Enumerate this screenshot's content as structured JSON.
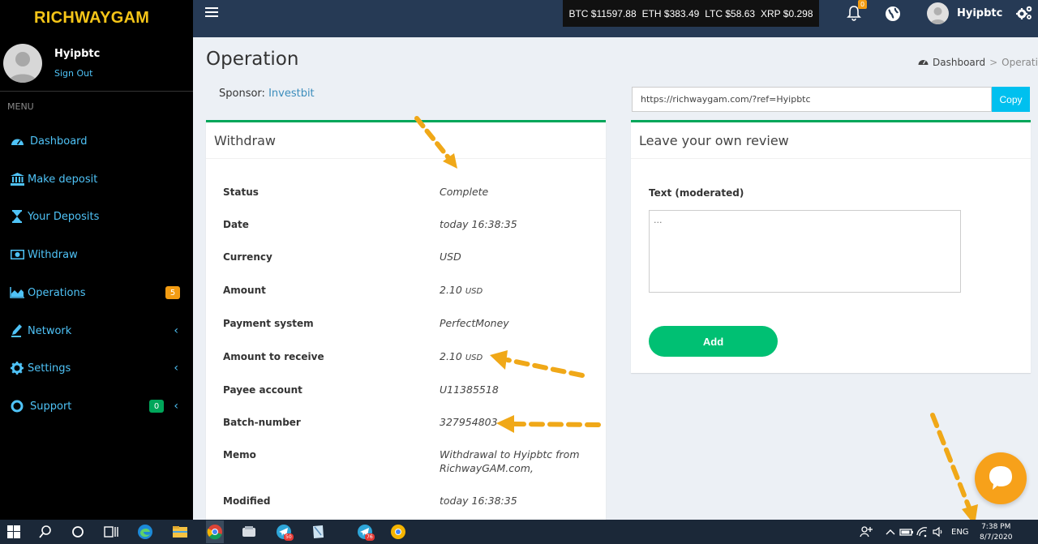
{
  "brand": "RICHWAYGAM",
  "user": {
    "name": "Hyipbtc",
    "sign_out": "Sign Out"
  },
  "menu": {
    "header": "MENU",
    "items": [
      {
        "label": "Dashboard",
        "icon": "dashboard-icon"
      },
      {
        "label": "Make deposit",
        "icon": "bank-icon"
      },
      {
        "label": "Your Deposits",
        "icon": "hourglass-icon"
      },
      {
        "label": "Withdraw",
        "icon": "money-icon"
      },
      {
        "label": "Operations",
        "icon": "area-chart-icon",
        "badge": "5",
        "badge_color": "#f39c12"
      },
      {
        "label": "Network",
        "icon": "pen-icon",
        "chevron": "‹"
      },
      {
        "label": "Settings",
        "icon": "gear-icon",
        "chevron": "‹"
      },
      {
        "label": "Support",
        "icon": "lifebuoy-icon",
        "badge": "0",
        "badge_color": "#00a65a",
        "chevron": "‹"
      }
    ]
  },
  "topbar": {
    "ticker": [
      "BTC $11597.88",
      "ETH $383.49",
      "LTC $58.63",
      "XRP $0.298"
    ],
    "notifications": "0",
    "username": "Hyipbtc"
  },
  "page": {
    "title": "Operation",
    "breadcrumb": {
      "home": "Dashboard",
      "separator": ">",
      "current": "Operation"
    },
    "sponsor_label": "Sponsor:",
    "sponsor_name": "Investbit",
    "ref_link": "https://richwaygam.com/?ref=Hyipbtc",
    "copy_label": "Copy"
  },
  "withdraw": {
    "title": "Withdraw",
    "rows": [
      {
        "label": "Status",
        "value": "Complete"
      },
      {
        "label": "Date",
        "value": "today 16:38:35"
      },
      {
        "label": "Currency",
        "value": "USD"
      },
      {
        "label": "Amount",
        "value": "2.10",
        "unit": "USD"
      },
      {
        "label": "Payment system",
        "value": "PerfectMoney"
      },
      {
        "label": "Amount to receive",
        "value": "2.10",
        "unit": "USD"
      },
      {
        "label": "Payee account",
        "value": "U11385518"
      },
      {
        "label": "Batch-number",
        "value": "327954803"
      },
      {
        "label": "Memo",
        "value": "Withdrawal to Hyipbtc from RichwayGAM.com,"
      },
      {
        "label": "Modified",
        "value": "today 16:38:35"
      }
    ]
  },
  "review": {
    "title": "Leave your own review",
    "text_label": "Text (moderated)",
    "placeholder": "...",
    "add_label": "Add"
  },
  "taskbar": {
    "badge_telegram_1": "50",
    "badge_telegram_2": "76",
    "lang": "ENG",
    "time": "7:38 PM",
    "date": "8/7/2020"
  },
  "colors": {
    "accent_green": "#00a65a",
    "brand_yellow": "#f5c518",
    "link_blue": "#4fc3f7",
    "topbar": "#263a55",
    "annotation_arrow": "#f0a818"
  }
}
